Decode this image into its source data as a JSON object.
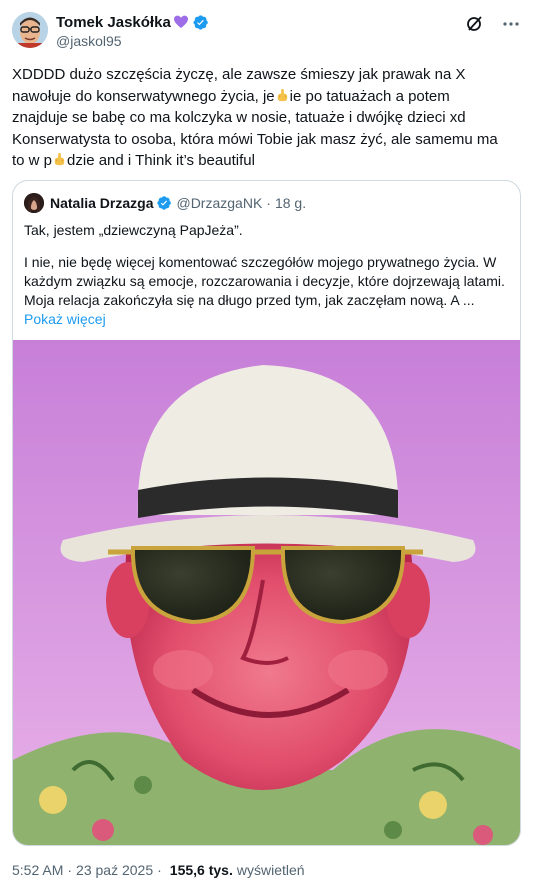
{
  "author": {
    "display_name": "Tomek Jaskółka",
    "handle": "@jaskol95",
    "heart_icon": "purple-heart-emoji",
    "verified_icon": "verified-badge-icon"
  },
  "tweet": {
    "lines": [
      "XDDDD dużo szczęścia życzę, ale zawsze śmieszy jak prawak na X",
      "nawołuje do konserwatywnego życia, je",
      "ie po tatuażach a potem",
      "znajduje se babę co ma kolczyka w nosie, tatuaże i dwójkę dzieci xd",
      "Konserwatysta to osoba, która mówi Tobie jak masz żyć, ale samemu ma",
      "to w p",
      "dzie and i Think it’s beautiful"
    ]
  },
  "quote": {
    "display_name": "Natalia Drzazga",
    "handle": "@DrzazgaNK",
    "separator": "·",
    "time": "18 g.",
    "lines": [
      "Tak, jestem „dziewczyną PapJeża”.",
      "I nie, nie będę więcej komentować szczegółów mojego prywatnego życia. W",
      "każdym związku są emocje, rozczarowania i decyzje, które dojrzewają latami.",
      "Moja relacja zakończyła się na długo przed tym, jak zaczęłam nową. A ..."
    ],
    "show_more": "Pokaż więcej"
  },
  "meta": {
    "time": "5:52 AM",
    "dot1": "·",
    "date": "23 paź 2025",
    "dot2": "·",
    "views_count": "155,6 tys.",
    "views_label": "wyświetleń"
  },
  "colors": {
    "accent": "#1d9bf0",
    "text": "#0f1419",
    "secondary": "#536471",
    "border": "#cfd9de",
    "heart": "#9d6ee8"
  }
}
